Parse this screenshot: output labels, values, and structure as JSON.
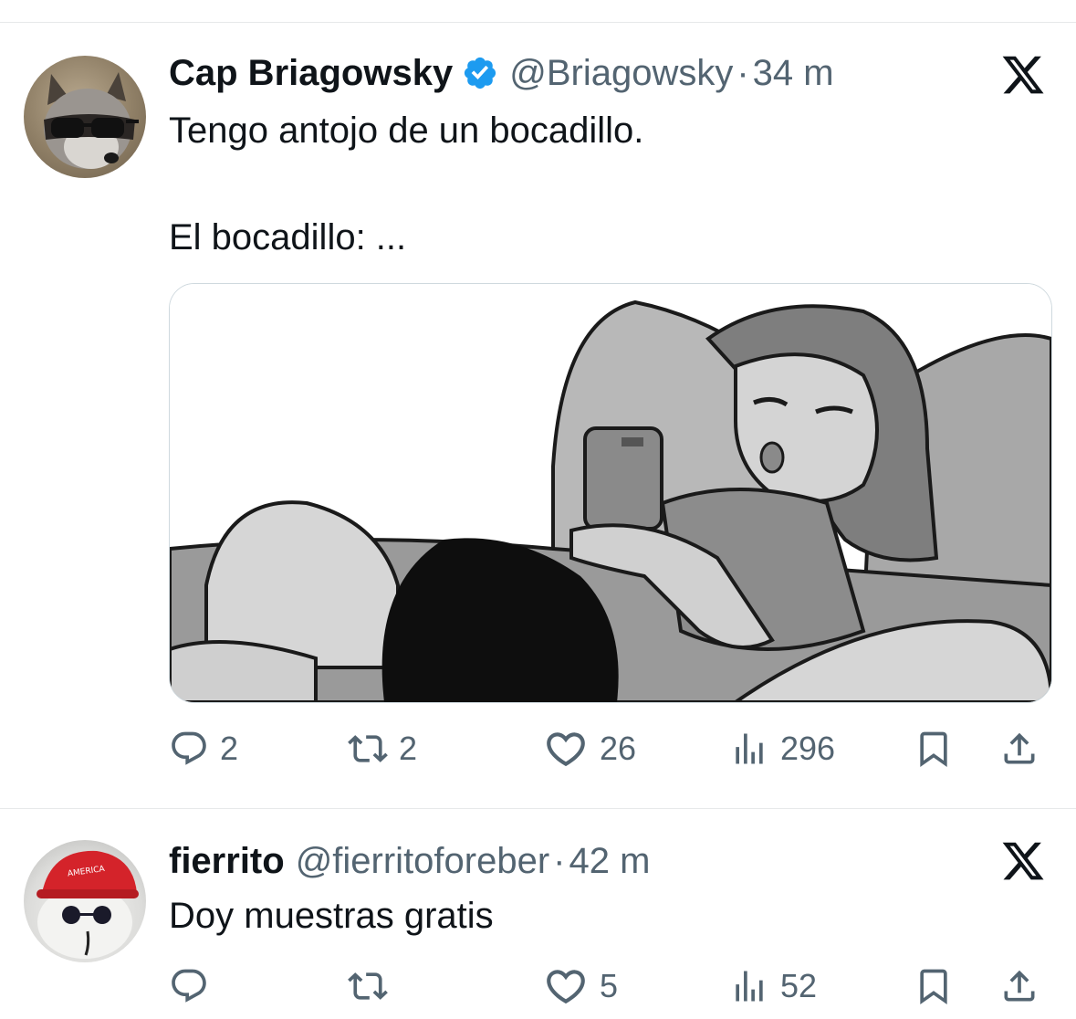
{
  "tweets": [
    {
      "author_name": "Cap Briagowsky",
      "handle": "@Briagowsky",
      "separator": "·",
      "time": "34 m",
      "verified": true,
      "text_line1": "Tengo antojo de un bocadillo.",
      "text_line2": "El bocadillo: ...",
      "avatar_icon": "raccoon-with-sunglasses",
      "media": "grayscale-cartoon-illustration",
      "stats": {
        "replies": "2",
        "retweets": "2",
        "likes": "26",
        "views": "296"
      }
    },
    {
      "author_name": "fierrito",
      "handle": "@fierritoforeber",
      "separator": "·",
      "time": "42 m",
      "verified": false,
      "text_line1": "Doy muestras gratis",
      "avatar_icon": "white-cat-with-red-cap",
      "stats": {
        "replies": "",
        "retweets": "",
        "likes": "5",
        "views": "52"
      }
    }
  ],
  "icons": {
    "reply": "speech-bubble-icon",
    "retweet": "retweet-icon",
    "like": "heart-icon",
    "views": "bar-chart-icon",
    "bookmark": "bookmark-icon",
    "share": "share-icon",
    "platform": "x-logo"
  },
  "colors": {
    "text": "#0f1419",
    "secondary": "#536471",
    "verified_blue": "#1d9bf0",
    "divider": "#e7e9ea"
  }
}
